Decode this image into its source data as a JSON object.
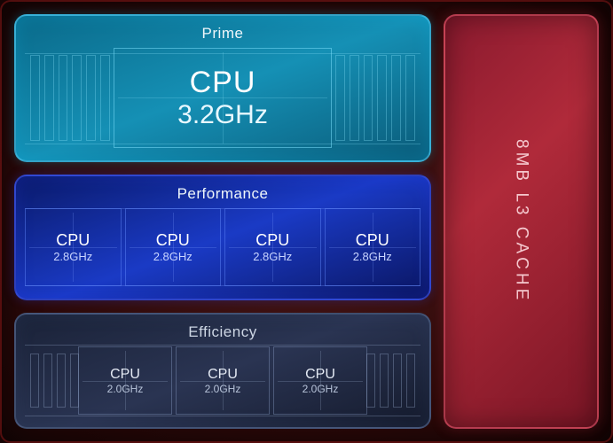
{
  "cache": {
    "label": "8MB L3 CACHE"
  },
  "clusters": {
    "prime": {
      "title": "Prime",
      "cores": [
        {
          "label": "CPU",
          "freq": "3.2GHz"
        }
      ]
    },
    "performance": {
      "title": "Performance",
      "cores": [
        {
          "label": "CPU",
          "freq": "2.8GHz"
        },
        {
          "label": "CPU",
          "freq": "2.8GHz"
        },
        {
          "label": "CPU",
          "freq": "2.8GHz"
        },
        {
          "label": "CPU",
          "freq": "2.8GHz"
        }
      ]
    },
    "efficiency": {
      "title": "Efficiency",
      "cores": [
        {
          "label": "CPU",
          "freq": "2.0GHz"
        },
        {
          "label": "CPU",
          "freq": "2.0GHz"
        },
        {
          "label": "CPU",
          "freq": "2.0GHz"
        }
      ]
    }
  },
  "colors": {
    "prime": "#1590b5",
    "performance": "#1a3ac5",
    "efficiency": "#2a3452",
    "cache": "#9a1e30"
  }
}
